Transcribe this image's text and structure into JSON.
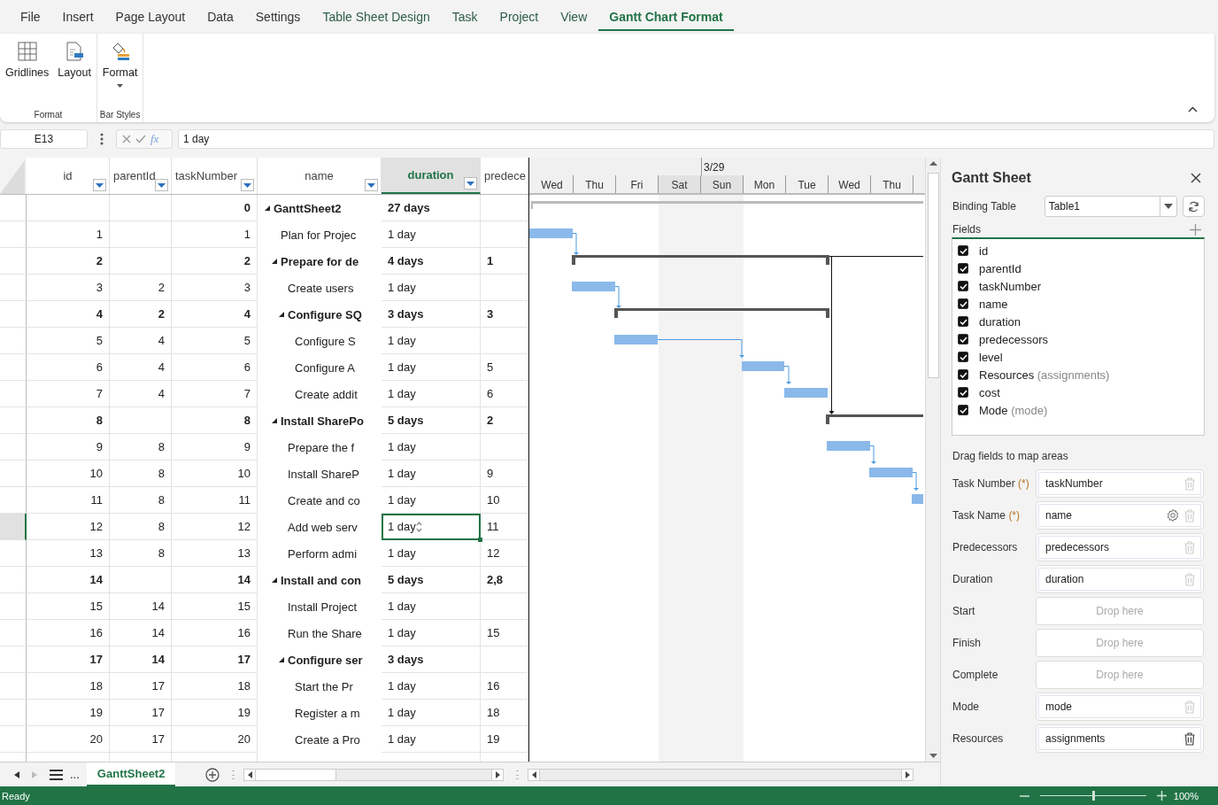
{
  "menu": [
    {
      "label": "File",
      "selected": false,
      "contextual": false
    },
    {
      "label": "Insert",
      "selected": false,
      "contextual": false
    },
    {
      "label": "Page Layout",
      "selected": false,
      "contextual": false
    },
    {
      "label": "Data",
      "selected": false,
      "contextual": false
    },
    {
      "label": "Settings",
      "selected": false,
      "contextual": false
    },
    {
      "label": "Table Sheet Design",
      "selected": false,
      "contextual": true
    },
    {
      "label": "Task",
      "selected": false,
      "contextual": true
    },
    {
      "label": "Project",
      "selected": false,
      "contextual": true
    },
    {
      "label": "View",
      "selected": false,
      "contextual": true
    },
    {
      "label": "Gantt Chart Format",
      "selected": true,
      "contextual": true
    }
  ],
  "ribbon": {
    "groups": [
      {
        "label": "Format",
        "buttons": [
          {
            "label": "Gridlines",
            "kind": "grid",
            "dropdown": false
          },
          {
            "label": "Layout",
            "kind": "layout",
            "dropdown": false
          }
        ]
      },
      {
        "label": "Bar Styles",
        "buttons": [
          {
            "label": "Format",
            "kind": "format",
            "dropdown": true
          }
        ]
      }
    ]
  },
  "formula_bar": {
    "name_box": "E13",
    "function_label": "fx",
    "value": "1 day"
  },
  "grid": {
    "columns": [
      {
        "label": "id",
        "kind": "number",
        "selected": false,
        "filter": true
      },
      {
        "label": "parentId",
        "kind": "number",
        "selected": false,
        "filter": true
      },
      {
        "label": "taskNumber",
        "kind": "number",
        "selected": false,
        "filter": true
      },
      {
        "label": "name",
        "kind": "tree",
        "selected": false,
        "filter": true
      },
      {
        "label": "duration",
        "kind": "text",
        "selected": true,
        "filter": true
      },
      {
        "label": "predece",
        "kind": "text",
        "selected": false,
        "filter": false
      }
    ],
    "rows": [
      {
        "taskNumber": "0",
        "name": "GanttSheet2",
        "duration": "27 days",
        "selected": false,
        "expanded": true,
        "children": [
          {
            "id": "1",
            "taskNumber": "1",
            "name": "Plan for Projec",
            "duration": "1 day",
            "selected": false
          },
          {
            "id": "2",
            "taskNumber": "2",
            "name": "Prepare for de",
            "duration": "4 days",
            "predecessors": "1",
            "selected": false,
            "expanded": true,
            "children": [
              {
                "id": "3",
                "parentId": "2",
                "taskNumber": "3",
                "name": "Create users",
                "duration": "1 day",
                "selected": false
              },
              {
                "id": "4",
                "parentId": "2",
                "taskNumber": "4",
                "name": "Configure SQ",
                "duration": "3 days",
                "predecessors": "3",
                "selected": false,
                "expanded": true,
                "children": [
                  {
                    "id": "5",
                    "parentId": "4",
                    "taskNumber": "5",
                    "name": "Configure S",
                    "duration": "1 day",
                    "selected": false
                  },
                  {
                    "id": "6",
                    "parentId": "4",
                    "taskNumber": "6",
                    "name": "Configure A",
                    "duration": "1 day",
                    "predecessors": "5",
                    "selected": false
                  },
                  {
                    "id": "7",
                    "parentId": "4",
                    "taskNumber": "7",
                    "name": "Create addit",
                    "duration": "1 day",
                    "predecessors": "6",
                    "selected": false
                  }
                ]
              }
            ]
          },
          {
            "id": "8",
            "taskNumber": "8",
            "name": "Install SharePo",
            "duration": "5 days",
            "predecessors": "2",
            "selected": false,
            "expanded": true,
            "children": [
              {
                "id": "9",
                "parentId": "8",
                "taskNumber": "9",
                "name": "Prepare the f",
                "duration": "1 day",
                "selected": false
              },
              {
                "id": "10",
                "parentId": "8",
                "taskNumber": "10",
                "name": "Install ShareP",
                "duration": "1 day",
                "predecessors": "9",
                "selected": false
              },
              {
                "id": "11",
                "parentId": "8",
                "taskNumber": "11",
                "name": "Create and co",
                "duration": "1 day",
                "predecessors": "10",
                "selected": false
              },
              {
                "id": "12",
                "parentId": "8",
                "taskNumber": "12",
                "name": "Add web serv",
                "duration": "1 day",
                "predecessors": "11",
                "selected": true
              },
              {
                "id": "13",
                "parentId": "8",
                "taskNumber": "13",
                "name": "Perform admi",
                "duration": "1 day",
                "predecessors": "12",
                "selected": false
              }
            ]
          },
          {
            "id": "14",
            "taskNumber": "14",
            "name": "Install and con",
            "duration": "5 days",
            "predecessors": "2,8",
            "selected": false,
            "expanded": true,
            "children": [
              {
                "id": "15",
                "parentId": "14",
                "taskNumber": "15",
                "name": "Install Project",
                "duration": "1 day",
                "selected": false
              },
              {
                "id": "16",
                "parentId": "14",
                "taskNumber": "16",
                "name": "Run the Share",
                "duration": "1 day",
                "predecessors": "15",
                "selected": false
              },
              {
                "id": "17",
                "parentId": "14",
                "taskNumber": "17",
                "name": "Configure ser",
                "duration": "3 days",
                "selected": false,
                "expanded": true,
                "children": [
                  {
                    "id": "18",
                    "parentId": "17",
                    "taskNumber": "18",
                    "name": "Start the Pr",
                    "duration": "1 day",
                    "predecessors": "16",
                    "selected": false
                  },
                  {
                    "id": "19",
                    "parentId": "17",
                    "taskNumber": "19",
                    "name": "Register a m",
                    "duration": "1 day",
                    "predecessors": "18",
                    "selected": false
                  },
                  {
                    "id": "20",
                    "parentId": "17",
                    "taskNumber": "20",
                    "name": "Create a Pro",
                    "duration": "1 day",
                    "predecessors": "19",
                    "selected": false
                  }
                ]
              }
            ]
          }
        ]
      }
    ]
  },
  "gantt": {
    "days": [
      {
        "label": "Wed",
        "weekend": false
      },
      {
        "label": "Thu",
        "weekend": false
      },
      {
        "label": "Fri",
        "weekend": false
      },
      {
        "label": "Sat",
        "weekend": true
      },
      {
        "label": "Sun",
        "weekend": true,
        "date": "3/29"
      },
      {
        "label": "Mon",
        "weekend": false
      },
      {
        "label": "Tue",
        "weekend": false
      },
      {
        "label": "Wed",
        "weekend": false
      },
      {
        "label": "Thu",
        "weekend": false
      }
    ]
  },
  "sheet_tabs": {
    "more": "...",
    "tabs": [
      {
        "label": "GanttSheet2",
        "selected": true
      }
    ]
  },
  "panel": {
    "title": "Gantt Sheet",
    "binding_label": "Binding Table",
    "binding_value": "Table1",
    "fields_label": "Fields",
    "fields": [
      {
        "label": "id",
        "checked": true
      },
      {
        "label": "parentId",
        "checked": true
      },
      {
        "label": "taskNumber",
        "checked": true
      },
      {
        "label": "name",
        "checked": true
      },
      {
        "label": "duration",
        "checked": true
      },
      {
        "label": "predecessors",
        "checked": true
      },
      {
        "label": "level",
        "checked": true
      },
      {
        "label": "Resources",
        "alias": "(assignments)",
        "checked": true
      },
      {
        "label": "cost",
        "checked": true
      },
      {
        "label": "Mode",
        "alias": "(mode)",
        "checked": true
      }
    ],
    "map_label": "Drag fields to map areas",
    "mappings": [
      {
        "label": "Task Number",
        "required": "(*)",
        "value": "taskNumber",
        "settings": false,
        "trash_active": false
      },
      {
        "label": "Task Name",
        "required": "(*)",
        "value": "name",
        "settings": true,
        "trash_active": false
      },
      {
        "label": "Predecessors",
        "value": "predecessors",
        "settings": false,
        "trash_active": false
      },
      {
        "label": "Duration",
        "value": "duration",
        "settings": false,
        "trash_active": false
      },
      {
        "label": "Start",
        "hint": "Drop here"
      },
      {
        "label": "Finish",
        "hint": "Drop here"
      },
      {
        "label": "Complete",
        "hint": "Drop here"
      },
      {
        "label": "Mode",
        "value": "mode",
        "settings": false,
        "trash_active": false
      },
      {
        "label": "Resources",
        "value": "assignments",
        "settings": false,
        "trash_active": true
      }
    ]
  },
  "status_bar": {
    "text": "Ready",
    "zoom": {
      "level": 0.5,
      "reading": "100%"
    }
  }
}
